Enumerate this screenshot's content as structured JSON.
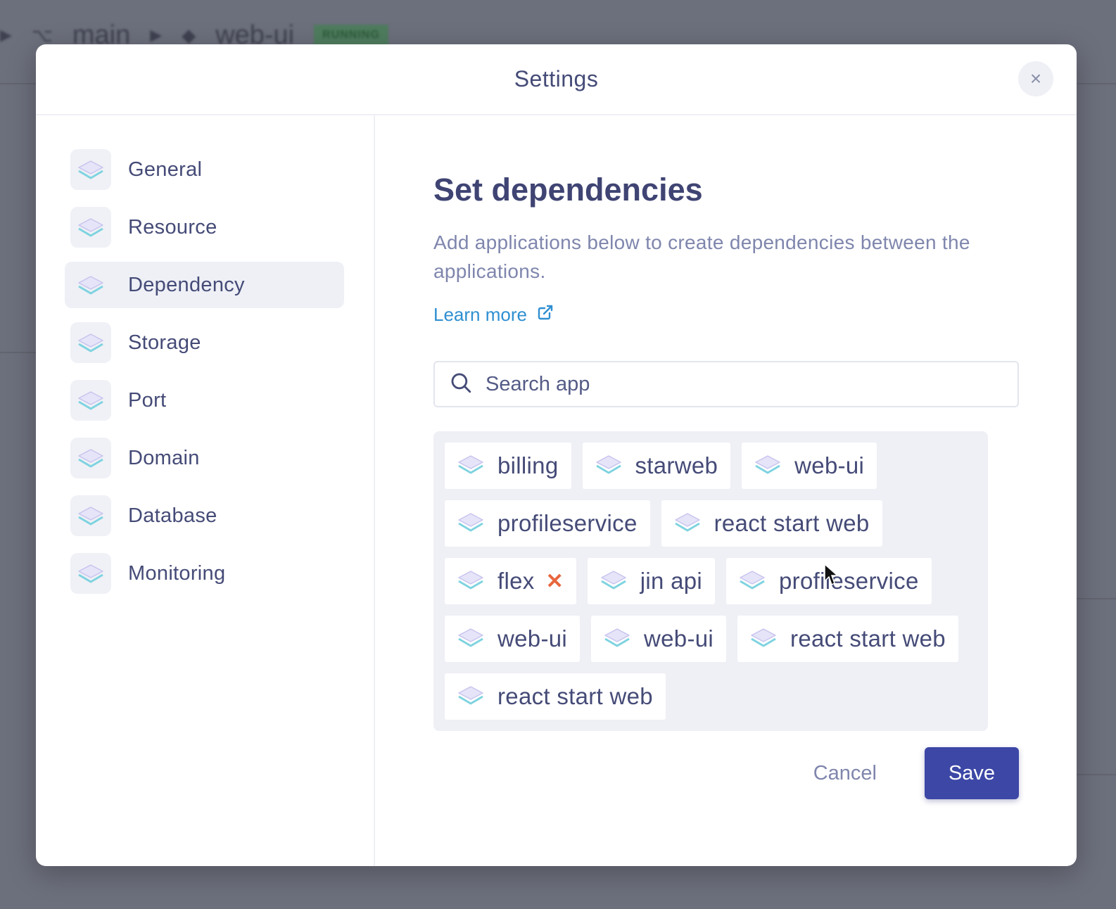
{
  "background": {
    "breadcrumb": [
      "main",
      "web-ui"
    ],
    "status_badge": "RUNNING"
  },
  "modal": {
    "title": "Settings",
    "close_icon": "close-icon"
  },
  "sidebar": {
    "items": [
      {
        "label": "General",
        "icon": "layers-icon",
        "active": false
      },
      {
        "label": "Resource",
        "icon": "layers-icon",
        "active": false
      },
      {
        "label": "Dependency",
        "icon": "layers-icon",
        "active": true
      },
      {
        "label": "Storage",
        "icon": "layers-icon",
        "active": false
      },
      {
        "label": "Port",
        "icon": "layers-icon",
        "active": false
      },
      {
        "label": "Domain",
        "icon": "layers-icon",
        "active": false
      },
      {
        "label": "Database",
        "icon": "layers-icon",
        "active": false
      },
      {
        "label": "Monitoring",
        "icon": "layers-icon",
        "active": false
      }
    ]
  },
  "content": {
    "heading": "Set dependencies",
    "description": "Add applications below to create dependencies between the applications.",
    "learn_more": "Learn more",
    "search": {
      "placeholder": "Search app",
      "value": ""
    },
    "apps": [
      {
        "label": "billing"
      },
      {
        "label": "starweb"
      },
      {
        "label": "web-ui"
      },
      {
        "label": "profileservice"
      },
      {
        "label": "react start web"
      },
      {
        "label": "flex",
        "removable": true
      },
      {
        "label": "jin api"
      },
      {
        "label": "profileservice"
      },
      {
        "label": "web-ui"
      },
      {
        "label": "web-ui"
      },
      {
        "label": "react start web"
      },
      {
        "label": "react start web"
      }
    ],
    "cancel_label": "Cancel",
    "save_label": "Save"
  },
  "colors": {
    "accent": "#3c47a6",
    "link": "#2f8fd1",
    "remove": "#e8663d",
    "text": "#454b77"
  }
}
